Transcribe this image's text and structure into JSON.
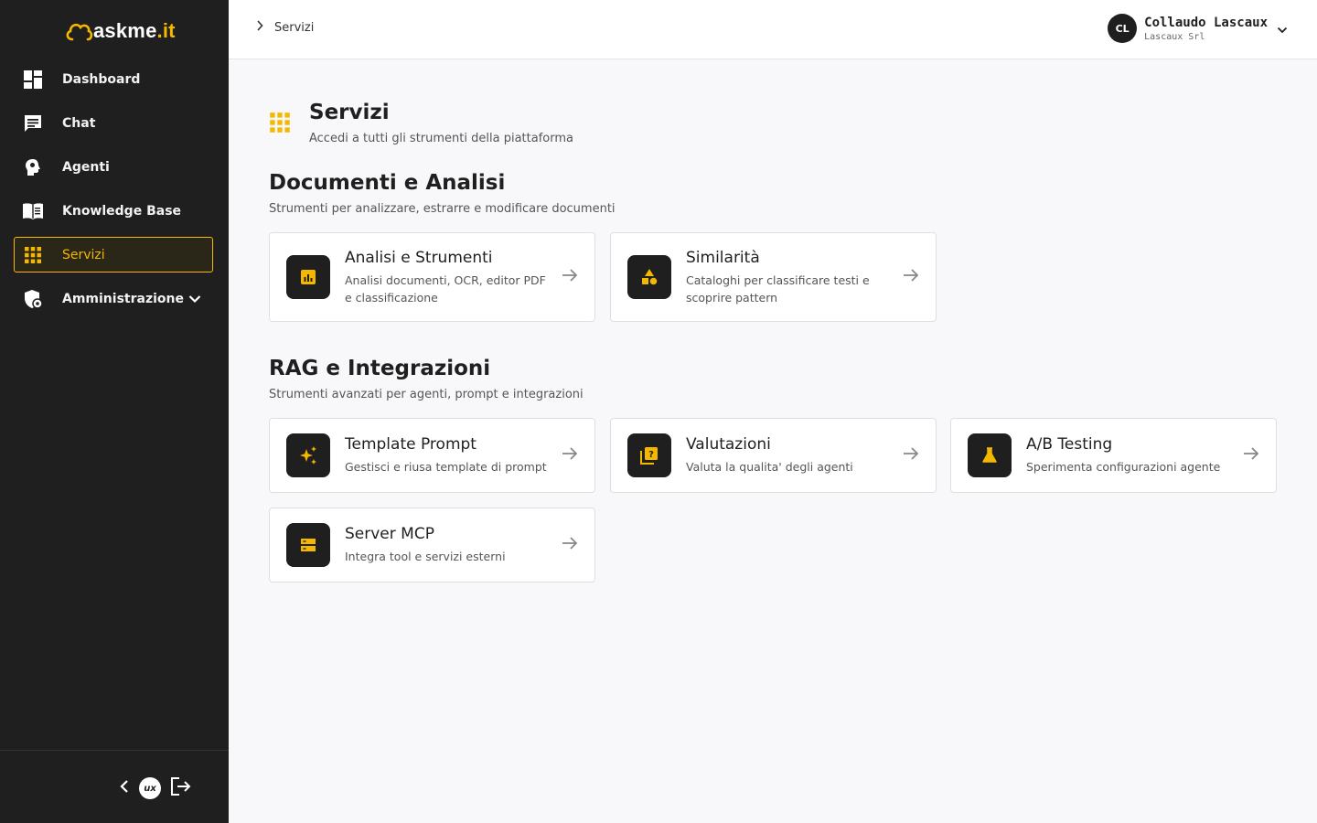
{
  "app": {
    "logo_text": "askme",
    "logo_dot": ".it"
  },
  "sidebar": {
    "items": [
      {
        "label": "Dashboard",
        "icon": "dashboard-icon"
      },
      {
        "label": "Chat",
        "icon": "chat-icon"
      },
      {
        "label": "Agenti",
        "icon": "agent-head-icon"
      },
      {
        "label": "Knowledge Base",
        "icon": "book-icon"
      },
      {
        "label": "Servizi",
        "icon": "grid-icon",
        "active": true
      },
      {
        "label": "Amministrazione",
        "icon": "admin-shield-icon",
        "expandable": true
      }
    ],
    "footer": {
      "ux_badge": "ux"
    }
  },
  "header": {
    "breadcrumb": {
      "current": "Servizi"
    },
    "user": {
      "initials": "CL",
      "name": "Collaudo Lascaux",
      "org": "Lascaux Srl"
    }
  },
  "page": {
    "title": "Servizi",
    "subtitle": "Accedi a tutti gli strumenti della piattaforma"
  },
  "sections": [
    {
      "title": "Documenti e Analisi",
      "subtitle": "Strumenti per analizzare, estrarre e modificare documenti",
      "cards": [
        {
          "title": "Analisi e Strumenti",
          "description": "Analisi documenti, OCR, editor PDF e classificazione",
          "icon": "analytics-icon"
        },
        {
          "title": "Similarità",
          "description": "Cataloghi per classificare testi e scoprire pattern",
          "icon": "shapes-icon"
        }
      ]
    },
    {
      "title": "RAG e Integrazioni",
      "subtitle": "Strumenti avanzati per agenti, prompt e integrazioni",
      "cards": [
        {
          "title": "Template Prompt",
          "description": "Gestisci e riusa template di prompt",
          "icon": "sparkle-icon"
        },
        {
          "title": "Valutazioni",
          "description": "Valuta la qualita' degli agenti",
          "icon": "quiz-icon"
        },
        {
          "title": "A/B Testing",
          "description": "Sperimenta configurazioni agente",
          "icon": "flask-icon"
        },
        {
          "title": "Server MCP",
          "description": "Integra tool e servizi esterni",
          "icon": "server-icon"
        }
      ]
    }
  ],
  "colors": {
    "accent": "#f5b800",
    "sidebar_bg": "#1f1f1f",
    "page_bg": "#f8f8fb"
  }
}
